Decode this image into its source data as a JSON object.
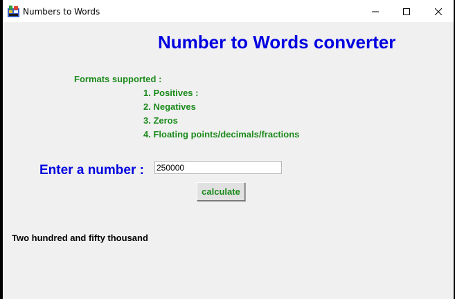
{
  "window": {
    "title": "Numbers to Words",
    "icon": "app-icon",
    "controls": {
      "minimize": "minimize-icon",
      "maximize": "maximize-icon",
      "close": "close-icon"
    }
  },
  "main": {
    "heading": "Number to Words converter",
    "formats_label": "Formats supported :",
    "formats": [
      "1. Positives :",
      "2. Negatives",
      "3. Zeros",
      "4. Floating points/decimals/fractions"
    ],
    "enter_label": "Enter a number :",
    "input_value": "250000",
    "calculate_label": "calculate",
    "result": "Two hundred and fifty thousand"
  },
  "colors": {
    "heading": "#0000e0",
    "formats": "#1b8a1b",
    "background": "#f0f0f0"
  }
}
